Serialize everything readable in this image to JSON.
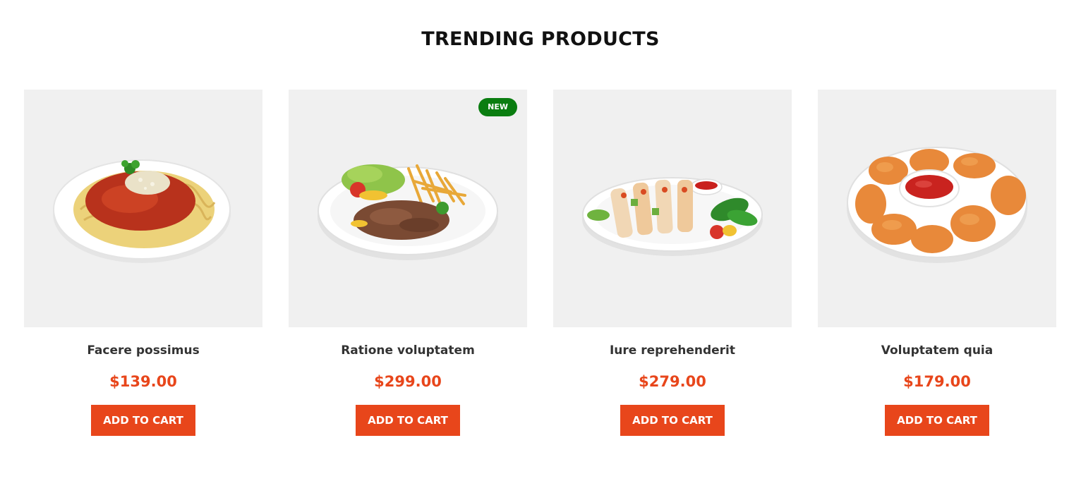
{
  "section": {
    "title": "TRENDING PRODUCTS"
  },
  "products": [
    {
      "name": "Facere possimus",
      "price": "$139.00",
      "cta": "ADD TO CART",
      "image": "spaghetti-bolognese"
    },
    {
      "name": "Ratione voluptatem",
      "price": "$299.00",
      "cta": "ADD TO CART",
      "badge": "NEW",
      "image": "kebab-plate-with-fries"
    },
    {
      "name": "Iure reprehenderit",
      "price": "$279.00",
      "cta": "ADD TO CART",
      "image": "chicken-skewers"
    },
    {
      "name": "Voluptatem quia",
      "price": "$179.00",
      "cta": "ADD TO CART",
      "image": "chicken-nuggets-with-ketchup"
    }
  ],
  "colors": {
    "accent": "#e8461b",
    "badge": "#0a7d10",
    "card_bg": "#f0f0f0",
    "title": "#111111",
    "name": "#333333"
  }
}
